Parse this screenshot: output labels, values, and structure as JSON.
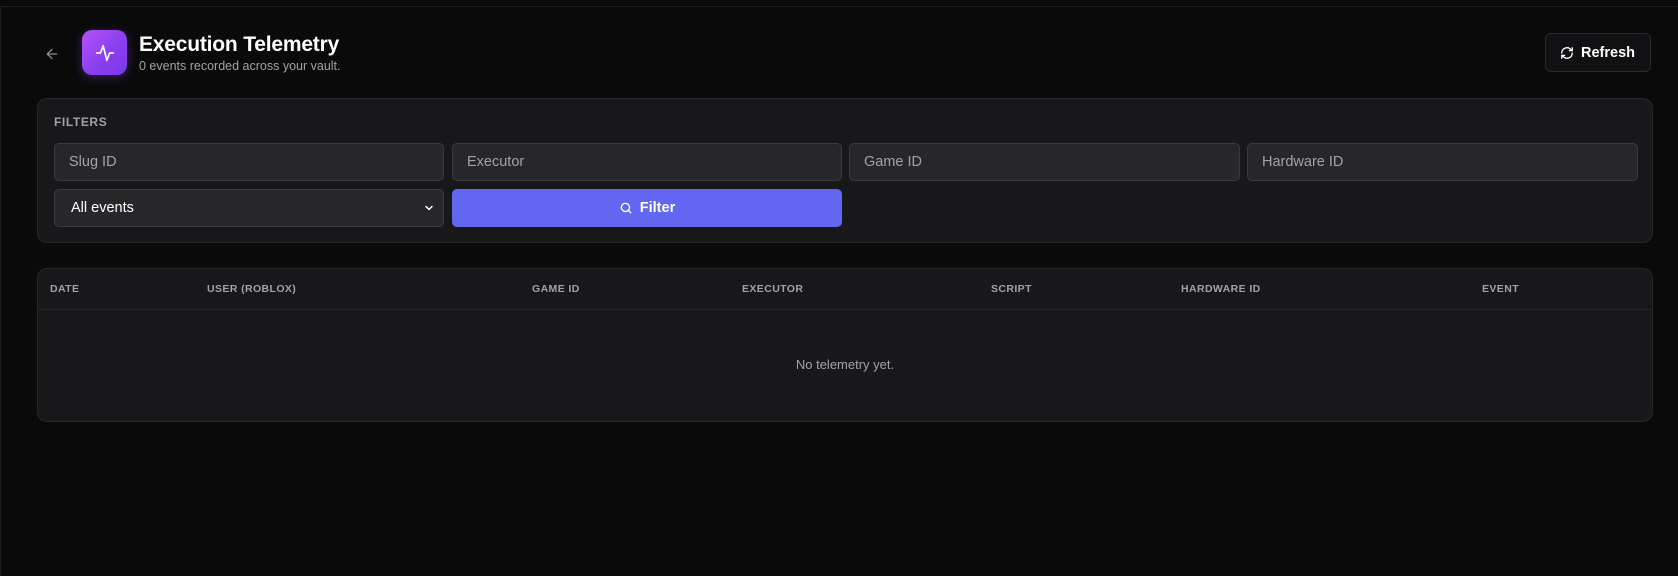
{
  "header": {
    "title": "Execution Telemetry",
    "subtitle": "0 events recorded across your vault.",
    "refresh_label": "Refresh"
  },
  "filters": {
    "section_label": "FILTERS",
    "fields": [
      {
        "placeholder": "Slug ID",
        "value": ""
      },
      {
        "placeholder": "Executor",
        "value": ""
      },
      {
        "placeholder": "Game ID",
        "value": ""
      },
      {
        "placeholder": "Hardware ID",
        "value": ""
      }
    ],
    "event_type": {
      "selected": "All events"
    },
    "filter_label": "Filter"
  },
  "table": {
    "columns": [
      "DATE",
      "USER (ROBLOX)",
      "GAME ID",
      "EXECUTOR",
      "SCRIPT",
      "HARDWARE ID",
      "EVENT"
    ],
    "rows": [],
    "empty_message": "No telemetry yet."
  },
  "colors": {
    "accent": "#6366f1",
    "logo_gradient_start": "#b653f5",
    "logo_gradient_end": "#7a38e8",
    "background": "#0a0a0a",
    "card": "#18181b"
  },
  "icons": {
    "back": "arrow-left-icon",
    "logo": "activity-pulse-icon",
    "refresh": "refresh-icon",
    "search": "search-icon",
    "select": "chevron-down-icon"
  }
}
